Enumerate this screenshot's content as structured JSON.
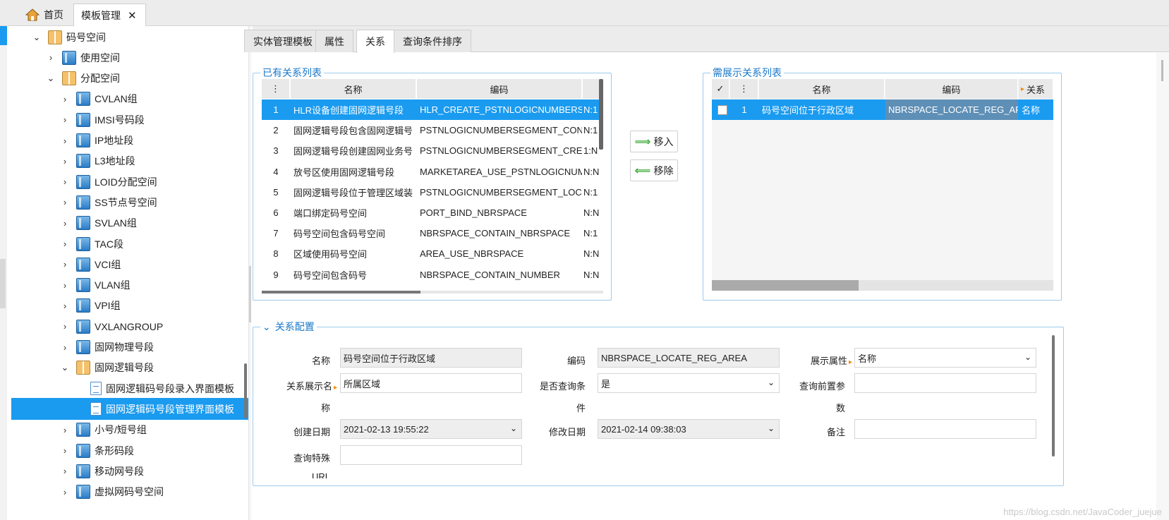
{
  "top_tabs": {
    "home": "首页",
    "active": "模板管理"
  },
  "tree": [
    {
      "label": "码号空间",
      "level": 1,
      "expanded": true,
      "icon": "book"
    },
    {
      "label": "使用空间",
      "level": 2,
      "expanded": false,
      "icon": "block"
    },
    {
      "label": "分配空间",
      "level": 2,
      "expanded": true,
      "icon": "book"
    },
    {
      "label": "CVLAN组",
      "level": 3,
      "expanded": false,
      "icon": "block"
    },
    {
      "label": "IMSI号码段",
      "level": 3,
      "expanded": false,
      "icon": "block"
    },
    {
      "label": "IP地址段",
      "level": 3,
      "expanded": false,
      "icon": "block"
    },
    {
      "label": "L3地址段",
      "level": 3,
      "expanded": false,
      "icon": "block"
    },
    {
      "label": "LOID分配空间",
      "level": 3,
      "expanded": false,
      "icon": "block"
    },
    {
      "label": "SS节点号空间",
      "level": 3,
      "expanded": false,
      "icon": "block"
    },
    {
      "label": "SVLAN组",
      "level": 3,
      "expanded": false,
      "icon": "block"
    },
    {
      "label": "TAC段",
      "level": 3,
      "expanded": false,
      "icon": "block"
    },
    {
      "label": "VCI组",
      "level": 3,
      "expanded": false,
      "icon": "block"
    },
    {
      "label": "VLAN组",
      "level": 3,
      "expanded": false,
      "icon": "block"
    },
    {
      "label": "VPI组",
      "level": 3,
      "expanded": false,
      "icon": "block"
    },
    {
      "label": "VXLANGROUP",
      "level": 3,
      "expanded": false,
      "icon": "block"
    },
    {
      "label": "固网物理号段",
      "level": 3,
      "expanded": false,
      "icon": "block"
    },
    {
      "label": "固网逻辑号段",
      "level": 3,
      "expanded": true,
      "icon": "book"
    },
    {
      "label": "固网逻辑码号段录入界面模板",
      "level": 4,
      "leaf": true,
      "icon": "doc"
    },
    {
      "label": "固网逻辑码号段管理界面模板",
      "level": 4,
      "leaf": true,
      "icon": "doc",
      "selected": true
    },
    {
      "label": "小号/短号组",
      "level": 3,
      "expanded": false,
      "icon": "block"
    },
    {
      "label": "条形码段",
      "level": 3,
      "expanded": false,
      "icon": "block"
    },
    {
      "label": "移动网号段",
      "level": 3,
      "expanded": false,
      "icon": "block"
    },
    {
      "label": "虚拟网码号空间",
      "level": 3,
      "expanded": false,
      "icon": "block"
    }
  ],
  "sub_tabs": [
    "实体管理模板",
    "属性",
    "关系",
    "查询条件排序"
  ],
  "active_sub_tab": "关系",
  "existing": {
    "legend": "已有关系列表",
    "headers": {
      "menu": "⋮",
      "name": "名称",
      "code": "编码"
    },
    "rows": [
      {
        "n": "1",
        "name": "HLR设备创建固网逻辑号段",
        "code": "HLR_CREATE_PSTNLOGICNUMBERSE",
        "card": "N:1",
        "selected": true
      },
      {
        "n": "2",
        "name": "固网逻辑号段包含固网逻辑号",
        "code": "PSTNLOGICNUMBERSEGMENT_CON",
        "card": "N:1"
      },
      {
        "n": "3",
        "name": "固网逻辑号段创建固网业务号",
        "code": "PSTNLOGICNUMBERSEGMENT_CREA",
        "card": "1:N"
      },
      {
        "n": "4",
        "name": "放号区使用固网逻辑号段",
        "code": "MARKETAREA_USE_PSTNLOGICNUM",
        "card": "N:N"
      },
      {
        "n": "5",
        "name": "固网逻辑号段位于管理区域装",
        "code": "PSTNLOGICNUMBERSEGMENT_LOCA",
        "card": "N:1"
      },
      {
        "n": "6",
        "name": "端口绑定码号空间",
        "code": "PORT_BIND_NBRSPACE",
        "card": "N:N"
      },
      {
        "n": "7",
        "name": "码号空间包含码号空间",
        "code": "NBRSPACE_CONTAIN_NBRSPACE",
        "card": "N:1"
      },
      {
        "n": "8",
        "name": "区域使用码号空间",
        "code": "AREA_USE_NBRSPACE",
        "card": "N:N"
      },
      {
        "n": "9",
        "name": "码号空间包含码号",
        "code": "NBRSPACE_CONTAIN_NUMBER",
        "card": "N:N"
      }
    ]
  },
  "buttons": {
    "move_in": "移入",
    "move_out": "移除"
  },
  "display": {
    "legend": "需展示关系列表",
    "headers": {
      "check": "✓",
      "menu": "⋮",
      "name": "名称",
      "code": "编码",
      "rel": "关系"
    },
    "rows": [
      {
        "n": "1",
        "name": "码号空间位于行政区域",
        "code": "NBRSPACE_LOCATE_REG_ARE",
        "rel": "名称",
        "selected": true
      }
    ]
  },
  "config": {
    "legend": "关系配置",
    "name_label": "名称",
    "name_value": "码号空间位于行政区域",
    "code_label": "编码",
    "code_value": "NBRSPACE_LOCATE_REG_AREA",
    "show_attr_label": "展示属性",
    "show_attr_value": "名称",
    "rel_show_label_1": "关系展示名",
    "rel_show_label_2": "称",
    "rel_show_value": "所属区域",
    "is_query_label_1": "是否查询条",
    "is_query_label_2": "件",
    "is_query_value": "是",
    "query_pre_label_1": "查询前置参",
    "query_pre_label_2": "数",
    "query_pre_value": "",
    "created_label": "创建日期",
    "created_value": "2021-02-13 19:55:22",
    "modified_label": "修改日期",
    "modified_value": "2021-02-14 09:38:03",
    "remark_label": "备注",
    "remark_value": "",
    "special_label_1": "查询特殊",
    "special_label_2": "URL",
    "special_value": ""
  },
  "watermark": "https://blog.csdn.net/JavaCoder_juejue",
  "colors": {
    "accent": "#1a9bf0",
    "legend": "#1a78c9",
    "required": "#f08a00"
  }
}
